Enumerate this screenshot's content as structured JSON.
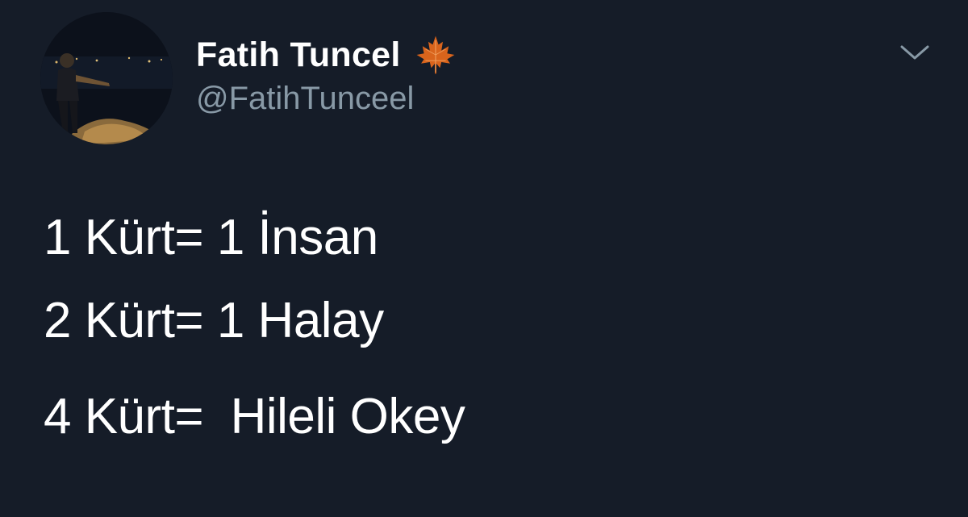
{
  "author": {
    "display_name": "Fatih Tuncel",
    "handle": "@FatihTunceel",
    "name_badge_icon": "maple-leaf-icon",
    "avatar_icon": "profile-photo"
  },
  "menu": {
    "icon": "chevron-down-icon"
  },
  "tweet": {
    "lines": [
      "1 Kürt= 1 İnsan",
      "2 Kürt= 1 Halay",
      "4 Kürt=  Hileli Okey"
    ]
  },
  "colors": {
    "background": "#151c28",
    "text_primary": "#ffffff",
    "text_secondary": "#8899a6",
    "leaf": "#d9641c"
  }
}
